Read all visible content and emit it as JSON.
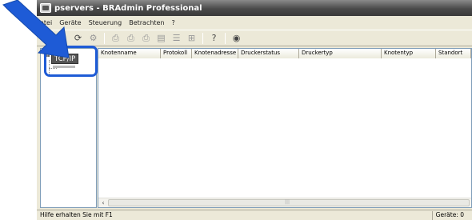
{
  "window": {
    "title": "pservers - BRAdmin Professional"
  },
  "menu": {
    "items": [
      "atei",
      "Geräte",
      "Steuerung",
      "Betrachten",
      "?"
    ]
  },
  "toolbar": {
    "icons": [
      "search-device-icon",
      "refresh-icon",
      "refresh-all-icon",
      "settings-icon",
      "printer-config-icon",
      "printer-icon",
      "printer-status-icon",
      "document-icon",
      "list-icon",
      "queue-icon",
      "help-icon",
      "network-icon"
    ]
  },
  "tree": {
    "selected_label": "TCP/IP"
  },
  "list": {
    "columns": [
      "Knotenname",
      "Protokoll",
      "Knotenadresse",
      "Druckerstatus",
      "Druckertyp",
      "Knotentyp",
      "Standort"
    ]
  },
  "status": {
    "left_text": "Hilfe erhalten Sie mit F1",
    "right_text": "Geräte: 0"
  },
  "colors": {
    "accent_arrow": "#1e5bd6",
    "titlebar": "#4a4a4a"
  }
}
